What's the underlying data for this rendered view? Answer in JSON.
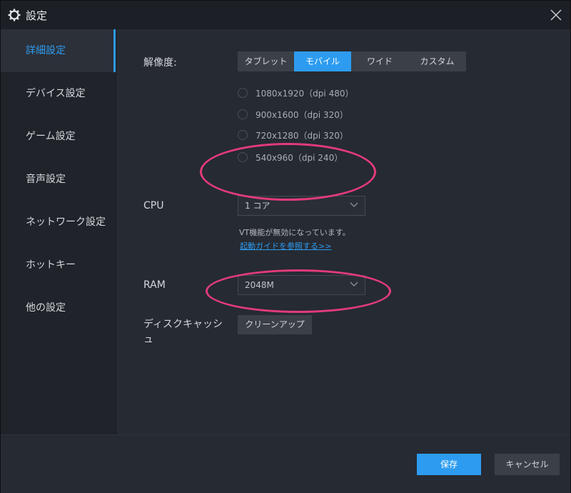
{
  "window": {
    "title": "設定",
    "title_icon": "gear-icon",
    "close_icon": "close-icon"
  },
  "sidebar": {
    "items": [
      {
        "label": "詳細設定",
        "active": true
      },
      {
        "label": "デバイス設定",
        "active": false
      },
      {
        "label": "ゲーム設定",
        "active": false
      },
      {
        "label": "音声設定",
        "active": false
      },
      {
        "label": "ネットワーク設定",
        "active": false
      },
      {
        "label": "ホットキー",
        "active": false
      },
      {
        "label": "他の設定",
        "active": false
      }
    ]
  },
  "resolution": {
    "label": "解像度:",
    "tabs": [
      {
        "label": "タブレット",
        "active": false
      },
      {
        "label": "モバイル",
        "active": true
      },
      {
        "label": "ワイド",
        "active": false
      },
      {
        "label": "カスタム",
        "active": false
      }
    ],
    "options": [
      "1080x1920（dpi 480）",
      "900x1600（dpi 320）",
      "720x1280（dpi 320）",
      "540x960（dpi 240）"
    ]
  },
  "cpu": {
    "label": "CPU",
    "value": "1 コア",
    "note": "VT機能が無効になっています。",
    "link": "起動ガイドを参照する>>"
  },
  "ram": {
    "label": "RAM",
    "value": "2048M"
  },
  "disk_cache": {
    "label_line1": "ディスクキャッシ",
    "label_line2": "ュ",
    "button": "クリーンアップ"
  },
  "footer": {
    "save": "保存",
    "cancel": "キャンセル"
  },
  "colors": {
    "accent": "#2d9cf0",
    "annotation": "#e23b7a",
    "background": "#262a32"
  }
}
